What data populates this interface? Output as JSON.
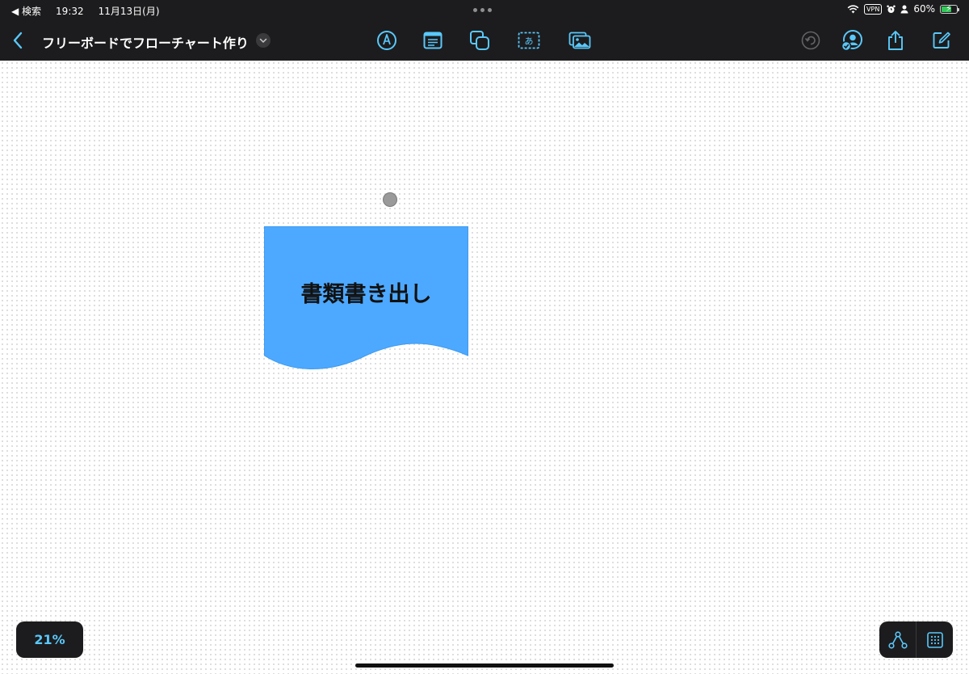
{
  "status_bar": {
    "back_app": "◀ 検索",
    "time": "19:32",
    "date": "11月13日(月)",
    "vpn": "VPN",
    "battery_percent": "60%",
    "battery_level": 0.6
  },
  "toolbar": {
    "title": "フリーボードでフローチャート作り",
    "icons": {
      "back": "chevron-left-icon",
      "title_menu": "chevron-down-icon",
      "pen": "pen-tool-icon",
      "sticky_note": "sticky-note-icon",
      "shapes": "shapes-icon",
      "text_box": "text-box-icon",
      "photo": "photo-icon",
      "undo": "undo-icon",
      "collaborate": "collaborate-icon",
      "share": "share-icon",
      "new_board": "compose-icon"
    },
    "accent_color": "#5ac8fa",
    "undo_disabled": true
  },
  "canvas": {
    "shape": {
      "type": "document-flowchart-shape",
      "label": "書類書き出し",
      "fill_color": "#4da9ff"
    }
  },
  "zoom": {
    "label": "21%"
  },
  "bottom_tools": {
    "connector": "connector-icon",
    "grid": "grid-icon"
  }
}
